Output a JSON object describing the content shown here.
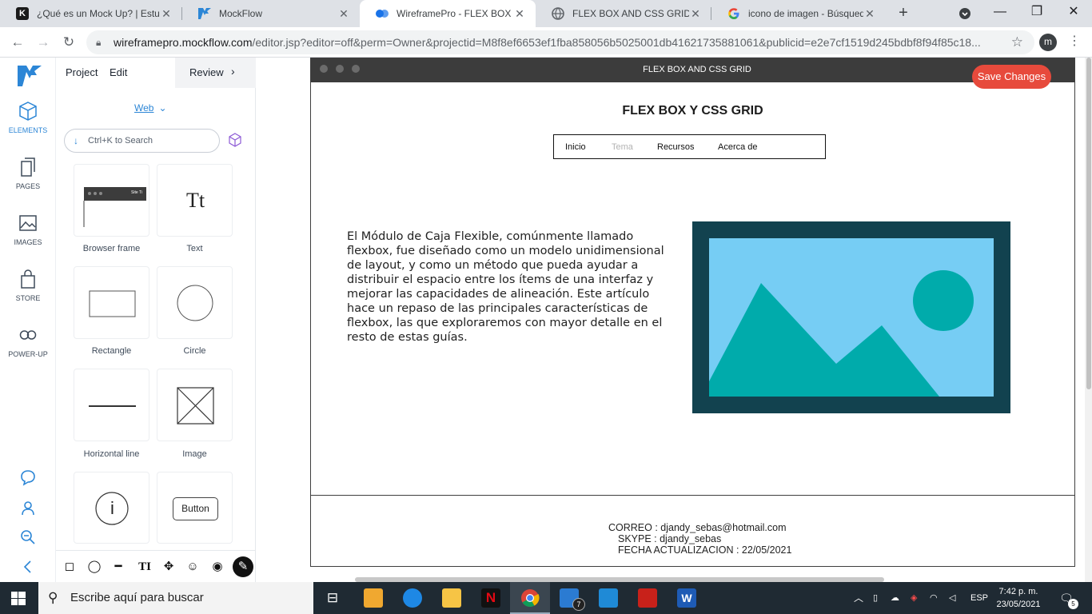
{
  "browser": {
    "tabs": [
      {
        "title": "¿Qué es un Mock Up? | Estudi",
        "icon": "k-icon"
      },
      {
        "title": "MockFlow",
        "icon": "mockflow-icon"
      },
      {
        "title": "WireframePro - FLEX BOX Y C",
        "icon": "wireframepro-icon",
        "active": true
      },
      {
        "title": "FLEX BOX AND CSS GRID",
        "icon": "globe-icon"
      },
      {
        "title": "icono de imagen - Búsqueda",
        "icon": "google-icon"
      }
    ],
    "url_host": "wireframepro.mockflow.com",
    "url_path": "/editor.jsp?editor=off&perm=Owner&projectid=M8f8ef6653ef1fba858056b5025001db41621735881061&publicid=e2e7cf1519d245bdbf8f94f85c18...",
    "profile_initial": "m"
  },
  "rail": {
    "items": [
      {
        "label": "ELEMENTS",
        "icon": "cube-icon",
        "active": true
      },
      {
        "label": "PAGES",
        "icon": "pages-icon"
      },
      {
        "label": "IMAGES",
        "icon": "image-icon"
      },
      {
        "label": "STORE",
        "icon": "bag-icon"
      },
      {
        "label": "POWER-UP",
        "icon": "infinity-icon"
      }
    ]
  },
  "panel": {
    "menu": {
      "project": "Project",
      "edit": "Edit",
      "review": "Review"
    },
    "platform": "Web",
    "search_placeholder": "Ctrl+K to Search",
    "elements": [
      {
        "label": "Browser frame",
        "thumb_text": "Site Ti"
      },
      {
        "label": "Text",
        "thumb_text": "Tt"
      },
      {
        "label": "Rectangle"
      },
      {
        "label": "Circle"
      },
      {
        "label": "Horizontal line"
      },
      {
        "label": "Image"
      },
      {
        "label": "",
        "thumb_text": "i"
      },
      {
        "label": "",
        "thumb_text": "Button"
      }
    ]
  },
  "editor": {
    "save_label": "Save Changes",
    "save_color": "#e74a3c"
  },
  "wireframe": {
    "frame_title": "FLEX BOX AND CSS GRID",
    "page_title": "FLEX BOX Y CSS GRID",
    "nav": [
      "Inicio",
      "Tema",
      "Recursos",
      "Acerca de"
    ],
    "paragraph": "El Módulo de Caja Flexible, comúnmente llamado flexbox, fue diseñado como un modelo unidimensional de layout, y como un método que pueda ayudar a distribuir el espacio entre los ítems de una interfaz y mejorar las capacidades de alineación. Este artículo hace un repaso de las principales características de flexbox, las que exploraremos con mayor detalle en el resto de estas guías.",
    "image_colors": {
      "frame": "#12424f",
      "sky": "#76cdf4",
      "land": "#00abab"
    },
    "footer": {
      "correo": "CORREO : djandy_sebas@hotmail.com",
      "skype": "SKYPE : djandy_sebas",
      "fecha": "FECHA ACTUALIZACION : 22/05/2021"
    }
  },
  "taskbar": {
    "search_placeholder": "Escribe aquí para buscar",
    "mail_badge": "7",
    "language": "ESP",
    "time": "7:42 p. m.",
    "date": "23/05/2021",
    "notifications": "5"
  }
}
